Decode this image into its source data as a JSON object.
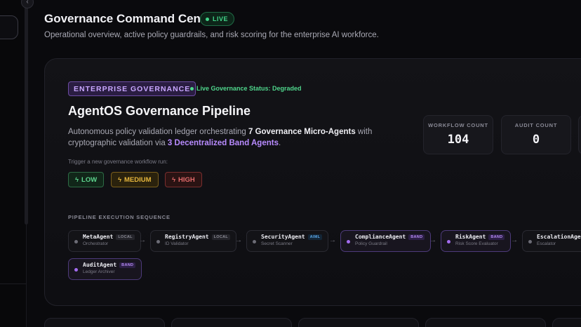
{
  "header": {
    "title": "Governance Command Center",
    "live_badge": "LIVE",
    "subtitle": "Operational overview, active policy guardrails, and risk scoring for the enterprise AI workforce."
  },
  "sidebar": {
    "collapse_icon": "chevron-left-icon",
    "collapse_glyph": "‹"
  },
  "pipeline": {
    "badge": "ENTERPRISE GOVERNANCE",
    "status": "Live Governance Status: Degraded",
    "title": "AgentOS Governance Pipeline",
    "description": {
      "part1": "Autonomous policy validation ledger orchestrating ",
      "highlight1": "7 Governance Micro-Agents",
      "part2": " with cryptographic validation via ",
      "highlight2": "3 Decentralized Band Agents",
      "part3": "."
    },
    "trigger_label": "Trigger a new governance workflow run:",
    "risk_buttons": [
      {
        "label": "LOW",
        "icon": "bolt-icon",
        "glyph": "ϟ"
      },
      {
        "label": "MEDIUM",
        "icon": "bolt-icon",
        "glyph": "ϟ"
      },
      {
        "label": "HIGH",
        "icon": "bolt-icon",
        "glyph": "ϟ"
      }
    ]
  },
  "stats": {
    "workflow_label": "WORKFLOW COUNT",
    "workflow_value": "104",
    "audit_label": "AUDIT COUNT",
    "audit_value": "0"
  },
  "sequence": {
    "label": "PIPELINE EXECUTION SEQUENCE",
    "arrow": "→",
    "agents": [
      {
        "name": "MetaAgent",
        "tag": "LOCAL",
        "sub": "Orchestrator"
      },
      {
        "name": "RegistryAgent",
        "tag": "LOCAL",
        "sub": "ID Validator"
      },
      {
        "name": "SecurityAgent",
        "tag": "AIML",
        "sub": "Secret Scanner"
      },
      {
        "name": "ComplianceAgent",
        "tag": "BAND",
        "sub": "Policy Guardrail"
      },
      {
        "name": "RiskAgent",
        "tag": "BAND",
        "sub": "Risk Score Evaluator"
      },
      {
        "name": "EscalationAgent",
        "tag": "",
        "sub": "Escalator"
      },
      {
        "name": "AuditAgent",
        "tag": "BAND",
        "sub": "Ledger Archiver"
      }
    ]
  },
  "colors": {
    "accent_purple": "#b88bff",
    "live_green": "#42d68a",
    "low": "#5ed68f",
    "medium": "#e6b63d",
    "high": "#e26a6a"
  }
}
